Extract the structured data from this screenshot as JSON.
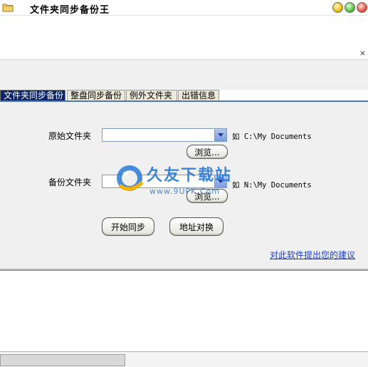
{
  "window": {
    "title": "文件夹同步备份王"
  },
  "panel": {
    "close_glyph": "×"
  },
  "tabs": [
    {
      "label": "文件夹同步备份",
      "active": true
    },
    {
      "label": "整盘同步备份",
      "active": false
    },
    {
      "label": "例外文件夹",
      "active": false
    },
    {
      "label": "出错信息",
      "active": false
    }
  ],
  "form": {
    "source_label": "原始文件夹",
    "source_value": "",
    "source_hint": "如 C:\\My Documents",
    "source_browse": "浏览...",
    "backup_label": "备份文件夹",
    "backup_value": "",
    "backup_hint": "如 N:\\My Documents",
    "backup_browse": "浏览..."
  },
  "actions": {
    "start_sync": "开始同步",
    "swap_paths": "地址对换"
  },
  "feedback_link": "对此软件提出您的建议",
  "watermark": {
    "text": "久友下载站",
    "url": "www.9UPK.Com"
  },
  "colors": {
    "tab_active_bg": "#0a246a",
    "link": "#1a3cc8"
  }
}
